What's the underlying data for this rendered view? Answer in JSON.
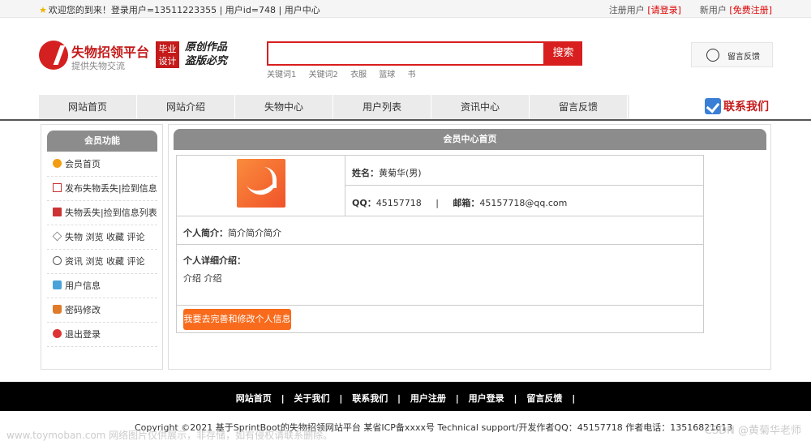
{
  "topbar": {
    "welcome": "欢迎您的到来！登录用户=13511223355 | 用户id=748 | 用户中心",
    "register_prefix": "注册用户",
    "login_link": "[请登录]",
    "new_user_prefix": "新用户",
    "free_register_link": "[免费注册]"
  },
  "header": {
    "logo_title": "失物招领平台",
    "logo_sub": "提供失物交流",
    "badge_line1": "毕业",
    "badge_line2": "设计",
    "slogan_line1": "原创作品",
    "slogan_line2": "盗版必究",
    "search_button": "搜索",
    "search_value": "",
    "keywords": [
      "关键词1",
      "关键词2",
      "衣服",
      "篮球",
      "书"
    ],
    "feedback": "留言反馈"
  },
  "nav": {
    "items": [
      "网站首页",
      "网站介绍",
      "失物中心",
      "用户列表",
      "资讯中心",
      "留言反馈"
    ],
    "contact": "联系我们"
  },
  "sidebar": {
    "title": "会员功能",
    "items": [
      {
        "label": "会员首页",
        "icon": "home-icon"
      },
      {
        "label": "发布失物丢失|捡到信息",
        "icon": "edit-icon"
      },
      {
        "label": "失物丢失|捡到信息列表",
        "icon": "list-icon"
      },
      {
        "label": "失物 浏览 收藏 评论",
        "icon": "star-icon"
      },
      {
        "label": "资讯 浏览 收藏 评论",
        "icon": "news-icon"
      },
      {
        "label": "用户信息",
        "icon": "user-icon"
      },
      {
        "label": "密码修改",
        "icon": "lock-icon"
      },
      {
        "label": "退出登录",
        "icon": "logout-icon"
      }
    ]
  },
  "main": {
    "title": "会员中心首页",
    "name_label": "姓名：",
    "name_value": "黄菊华(男)",
    "qq_label": "QQ：",
    "qq_value": "45157718",
    "separator": "|",
    "email_label": "邮箱：",
    "email_value": "45157718@qq.com",
    "intro_label": "个人简介：",
    "intro_value": "简介简介简介",
    "detail_label": "个人详细介绍：",
    "detail_value": "介绍  介绍",
    "edit_button": "我要去完善和修改个人信息"
  },
  "footer": {
    "links": [
      "网站首页",
      "|",
      "关于我们",
      "|",
      "联系我们",
      "|",
      "用户注册",
      "|",
      "用户登录",
      "|",
      "留言反馈",
      "|"
    ],
    "copyright": "Copyright ©2021 基于SprintBoot的失物招领网站平台   某省ICP备xxxx号   Technical support/开发作者QQ：45157718   作者电话：13516821613",
    "watermark_left": "www.toymoban.com 网络图片仅供展示，非存储，如有侵权请联系删除。",
    "watermark_right": "CSDN @黄菊华老师"
  },
  "colors": {
    "accent_red": "#d81e1e",
    "button_orange": "#f86b1c",
    "panel_gray": "#8c8c8c"
  }
}
